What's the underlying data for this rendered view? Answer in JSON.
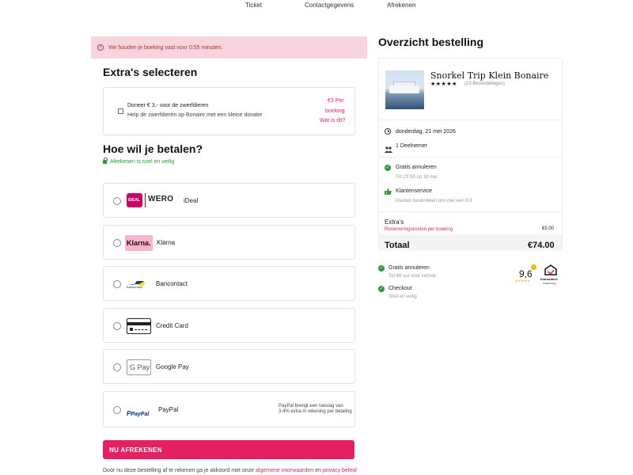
{
  "steps": [
    "Ticket",
    "Contactgegevens",
    "Afrekenen"
  ],
  "alert": {
    "text": "We houden je boeking vast voor 0:55 minuten."
  },
  "extras": {
    "heading": "Extra's selecteren",
    "donation_title": "Doneer € 3,- voor de zwerfdieren",
    "donation_desc": "Help de zwerfdieren op Bonaire met een kleine donatie",
    "price_line1": "€3  Per",
    "price_line2": "boeking",
    "more_link": "Wat is dit?"
  },
  "payment": {
    "heading": "Hoe wil je betalen?",
    "secure_text": "Afrekenen is snel en veilig",
    "methods": [
      {
        "label": "iDeal",
        "logo": "wero-ideal"
      },
      {
        "label": "Klarna",
        "logo": "klarna"
      },
      {
        "label": "Bancontact",
        "logo": "bancontact"
      },
      {
        "label": "Credit Card",
        "logo": "credit-card"
      },
      {
        "label": "Google Pay",
        "logo": "google-pay"
      },
      {
        "label": "PayPal",
        "logo": "paypal",
        "note_line1": "PayPal brengt een toeslag van",
        "note_line2": "3.4% extra in rekening per betaling"
      }
    ],
    "logo_text": {
      "wero": "WERO",
      "ideal": "iDEAL",
      "klarna": "Klarna.",
      "bancontact": "Bancontact",
      "gpay": "G Pay",
      "paypal": "PayPal"
    },
    "cta": "NU AFREKENEN",
    "terms_prefix": "Door nu deze bestelling af te rekenen ga je akkoord met onze",
    "terms_link": "algemene voorwaarden",
    "terms_and": "en",
    "privacy_link": "privacy beleid"
  },
  "summary": {
    "title": "Overzicht bestelling",
    "trip_title": "Snorkel Trip Klein Bonaire",
    "stars": "★★★★★",
    "reviews": "(23 Beoordelingen)",
    "date": "donderdag, 21 mei 2026",
    "participants": "1 Deelnemer",
    "cancel_title": "Gratis annuleren",
    "cancel_sub": "Tot 23:59 op 18 mei",
    "service_title": "Klantenservice",
    "service_sub": "Klanten beoordelen ons met een 9.8",
    "extras_label": "Extra's",
    "reservation_fee": "Reserveringskosten per boeking",
    "reservation_amount": "€5.00",
    "total_label": "Totaal",
    "total_amount": "€74.00"
  },
  "trust": {
    "cancel_title": "Gratis annuleren",
    "cancel_sub": "Tot 48 uur voor vertrek",
    "checkout_title": "Checkout",
    "checkout_sub": "Snel en veilig",
    "rating": "9,6",
    "rating_stars": "★★★★★",
    "badge_line1": "thuiswinkel",
    "badge_line2": "waarborg"
  },
  "colors": {
    "accent": "#e51f63",
    "success": "#2e9b3c",
    "alert_bg": "#f7d4de"
  }
}
